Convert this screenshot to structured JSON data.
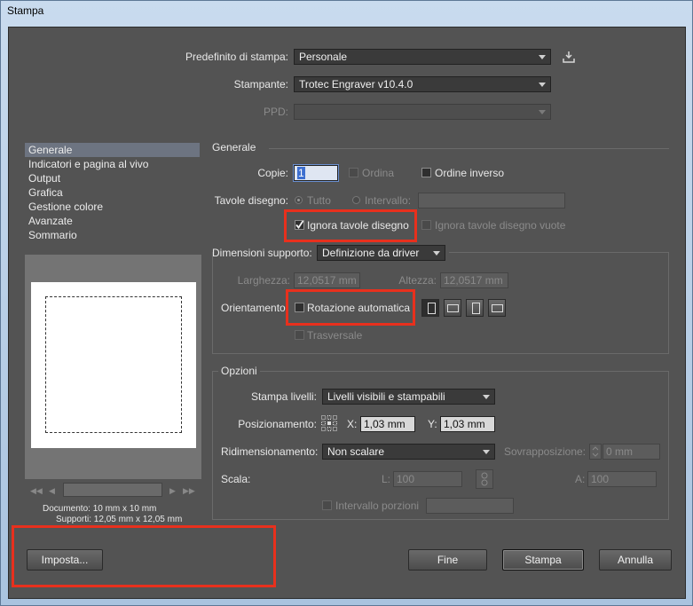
{
  "window": {
    "title": "Stampa"
  },
  "top": {
    "preset_label": "Predefinito di stampa:",
    "preset_value": "Personale",
    "printer_label": "Stampante:",
    "printer_value": "Trotec Engraver v10.4.0",
    "ppd_label": "PPD:",
    "ppd_value": ""
  },
  "sidebar": {
    "items": [
      {
        "label": "Generale",
        "selected": true
      },
      {
        "label": "Indicatori e pagina al vivo"
      },
      {
        "label": "Output"
      },
      {
        "label": "Grafica"
      },
      {
        "label": "Gestione colore"
      },
      {
        "label": "Avanzate"
      },
      {
        "label": "Sommario"
      }
    ]
  },
  "preview": {
    "document_label": "Documento: 10 mm x 10 mm",
    "media_label": "Supporti: 12,05 mm x 12,05 mm"
  },
  "general": {
    "section_title": "Generale",
    "copies_label": "Copie:",
    "copies_value": "1",
    "collate_label": "Ordina",
    "reverse_label": "Ordine inverso",
    "artboards_label": "Tavole disegno:",
    "all_label": "Tutto",
    "range_label": "Intervallo:",
    "range_value": "",
    "ignore_artboards_label": "Ignora tavole disegno",
    "ignore_artboards_checked": true,
    "skip_blank_label": "Ignora tavole disegno vuote"
  },
  "media": {
    "size_label": "Dimensioni supporto:",
    "size_value": "Definizione da driver",
    "width_label": "Larghezza:",
    "width_value": "12,0517 mm",
    "height_label": "Altezza:",
    "height_value": "12,0517 mm",
    "orientation_label": "Orientamento:",
    "auto_rotate_label": "Rotazione automatica",
    "transverse_label": "Trasversale"
  },
  "options": {
    "section_title": "Opzioni",
    "print_layers_label": "Stampa livelli:",
    "print_layers_value": "Livelli visibili e stampabili",
    "placement_label": "Posizionamento:",
    "x_label": "X:",
    "x_value": "1,03 mm",
    "y_label": "Y:",
    "y_value": "1,03 mm",
    "scaling_label": "Ridimensionamento:",
    "scaling_value": "Non scalare",
    "overlap_label": "Sovrapposizione:",
    "overlap_value": "0 mm",
    "scale_label": "Scala:",
    "w_label": "L:",
    "w_value": "100",
    "h_label": "A:",
    "h_value": "100",
    "tile_range_label": "Intervallo porzioni",
    "tile_range_value": ""
  },
  "buttons": {
    "setup": "Imposta...",
    "done": "Fine",
    "print": "Stampa",
    "cancel": "Annulla"
  },
  "colors": {
    "highlight": "#e8301d",
    "dialog_bg": "#535353"
  }
}
